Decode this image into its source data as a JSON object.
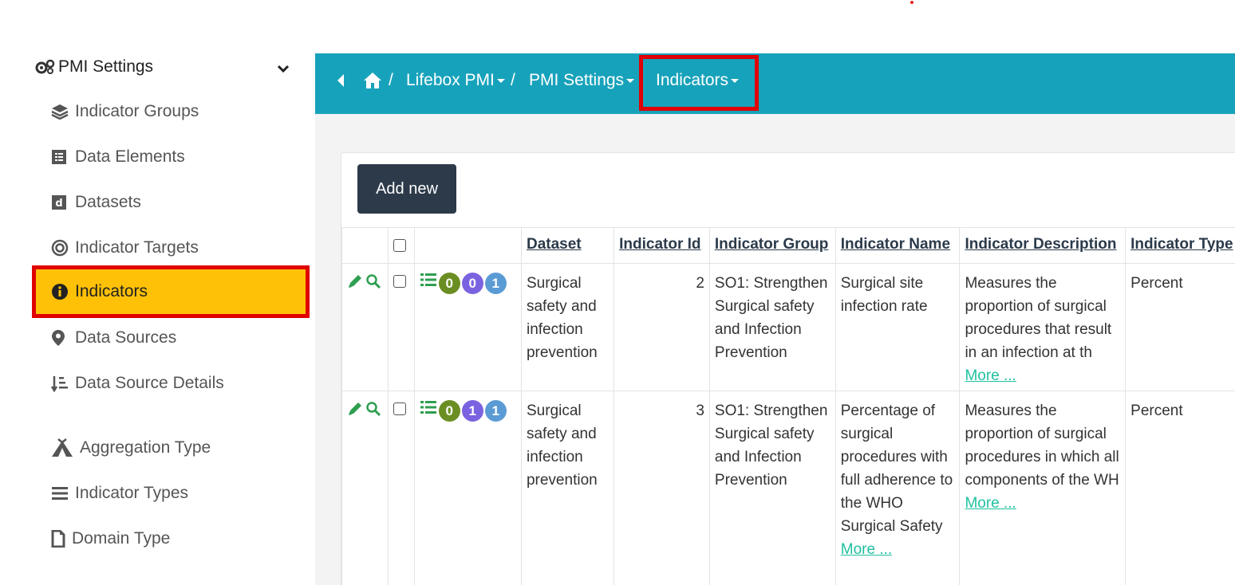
{
  "sidebar": {
    "header": "PMI Settings",
    "items": [
      {
        "label": "Indicator Groups",
        "icon": "layers-icon"
      },
      {
        "label": "Data Elements",
        "icon": "list-box-icon"
      },
      {
        "label": "Datasets",
        "icon": "d-box-icon"
      },
      {
        "label": "Indicator Targets",
        "icon": "target-icon"
      },
      {
        "label": "Indicators",
        "icon": "info-icon",
        "active": true
      },
      {
        "label": "Data Sources",
        "icon": "map-pin-icon"
      },
      {
        "label": "Data Source Details",
        "icon": "sort-list-icon"
      },
      {
        "label": "Aggregation Type",
        "icon": "tent-icon"
      },
      {
        "label": "Indicator Types",
        "icon": "bars-icon"
      },
      {
        "label": "Domain Type",
        "icon": "file-icon"
      }
    ]
  },
  "breadcrumb": {
    "items": [
      "Lifebox PMI",
      "PMI Settings",
      "Indicators"
    ],
    "separator": "/"
  },
  "toolbar": {
    "add_label": "Add new"
  },
  "table": {
    "columns": [
      "Dataset",
      "Indicator Id",
      "Indicator Group",
      "Indicator Name",
      "Indicator Description",
      "Indicator Type"
    ],
    "rows": [
      {
        "badges": [
          "0",
          "0",
          "1"
        ],
        "dataset": "Surgical safety and infection prevention",
        "id": "2",
        "group": "SO1: Strengthen Surgical safety and Infection Prevention",
        "name": "Surgical site infection rate",
        "name_more": "",
        "description": "Measures the proportion of surgical procedures that result in an infection at th",
        "more": "More ...",
        "type": "Percent"
      },
      {
        "badges": [
          "0",
          "1",
          "1"
        ],
        "dataset": "Surgical safety and infection prevention",
        "id": "3",
        "group": "SO1: Strengthen Surgical safety and Infection Prevention",
        "name": "Percentage of surgical procedures with full adherence to the WHO Surgical Safety",
        "name_more": "More ...",
        "description": "Measures the proportion of surgical procedures in which all components of the WH",
        "more": "More ...",
        "type": "Percent"
      }
    ]
  },
  "colors": {
    "topbar": "#17a2bb",
    "active_item": "#ffc107",
    "highlight_box": "#e00000",
    "add_button": "#2c3a4a",
    "link": "#20c0a0"
  }
}
